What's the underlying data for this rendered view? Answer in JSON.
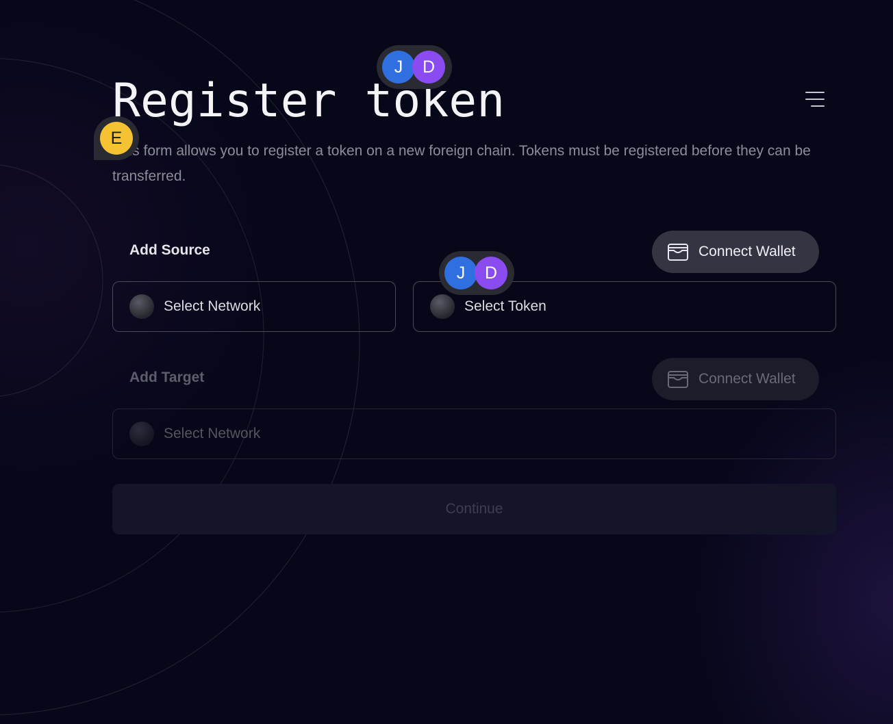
{
  "page": {
    "title": "Register token",
    "description": "This form allows you to register a token on a new foreign chain. Tokens must be registered before they can be transferred."
  },
  "source": {
    "label": "Add Source",
    "wallet_button": "Connect Wallet",
    "network_placeholder": "Select Network",
    "token_placeholder": "Select Token"
  },
  "target": {
    "label": "Add Target",
    "wallet_button": "Connect Wallet",
    "network_placeholder": "Select Network"
  },
  "continue_label": "Continue",
  "presence": {
    "title_group": [
      "J",
      "D"
    ],
    "field_group": [
      "J",
      "D"
    ],
    "description_user": "E"
  },
  "icons": {
    "menu": "hamburger-menu-icon",
    "wallet": "wallet-icon",
    "token": "token-placeholder-icon"
  },
  "colors": {
    "background": "#07071a",
    "avatar_j": "#2f6fe0",
    "avatar_d": "#8a4cf0",
    "avatar_e": "#f5c233"
  }
}
